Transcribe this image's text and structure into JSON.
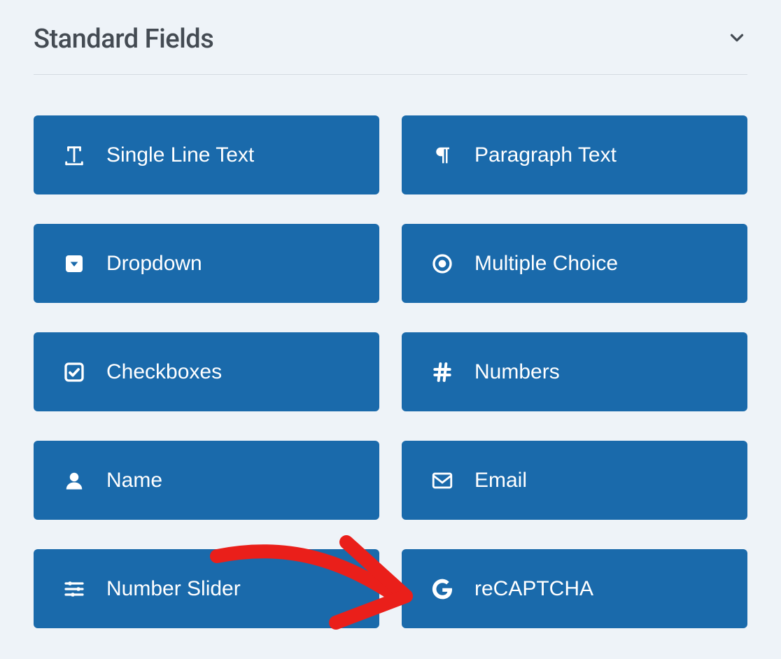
{
  "section": {
    "title": "Standard Fields"
  },
  "fields": [
    {
      "label": "Single Line Text",
      "icon": "text-icon"
    },
    {
      "label": "Paragraph Text",
      "icon": "paragraph-icon"
    },
    {
      "label": "Dropdown",
      "icon": "dropdown-icon"
    },
    {
      "label": "Multiple Choice",
      "icon": "radio-icon"
    },
    {
      "label": "Checkboxes",
      "icon": "checkbox-icon"
    },
    {
      "label": "Numbers",
      "icon": "hash-icon"
    },
    {
      "label": "Name",
      "icon": "person-icon"
    },
    {
      "label": "Email",
      "icon": "envelope-icon"
    },
    {
      "label": "Number Slider",
      "icon": "sliders-icon"
    },
    {
      "label": "reCAPTCHA",
      "icon": "google-icon"
    }
  ],
  "annotation": {
    "arrow_target": "reCAPTCHA",
    "color": "#ea1f1a"
  }
}
